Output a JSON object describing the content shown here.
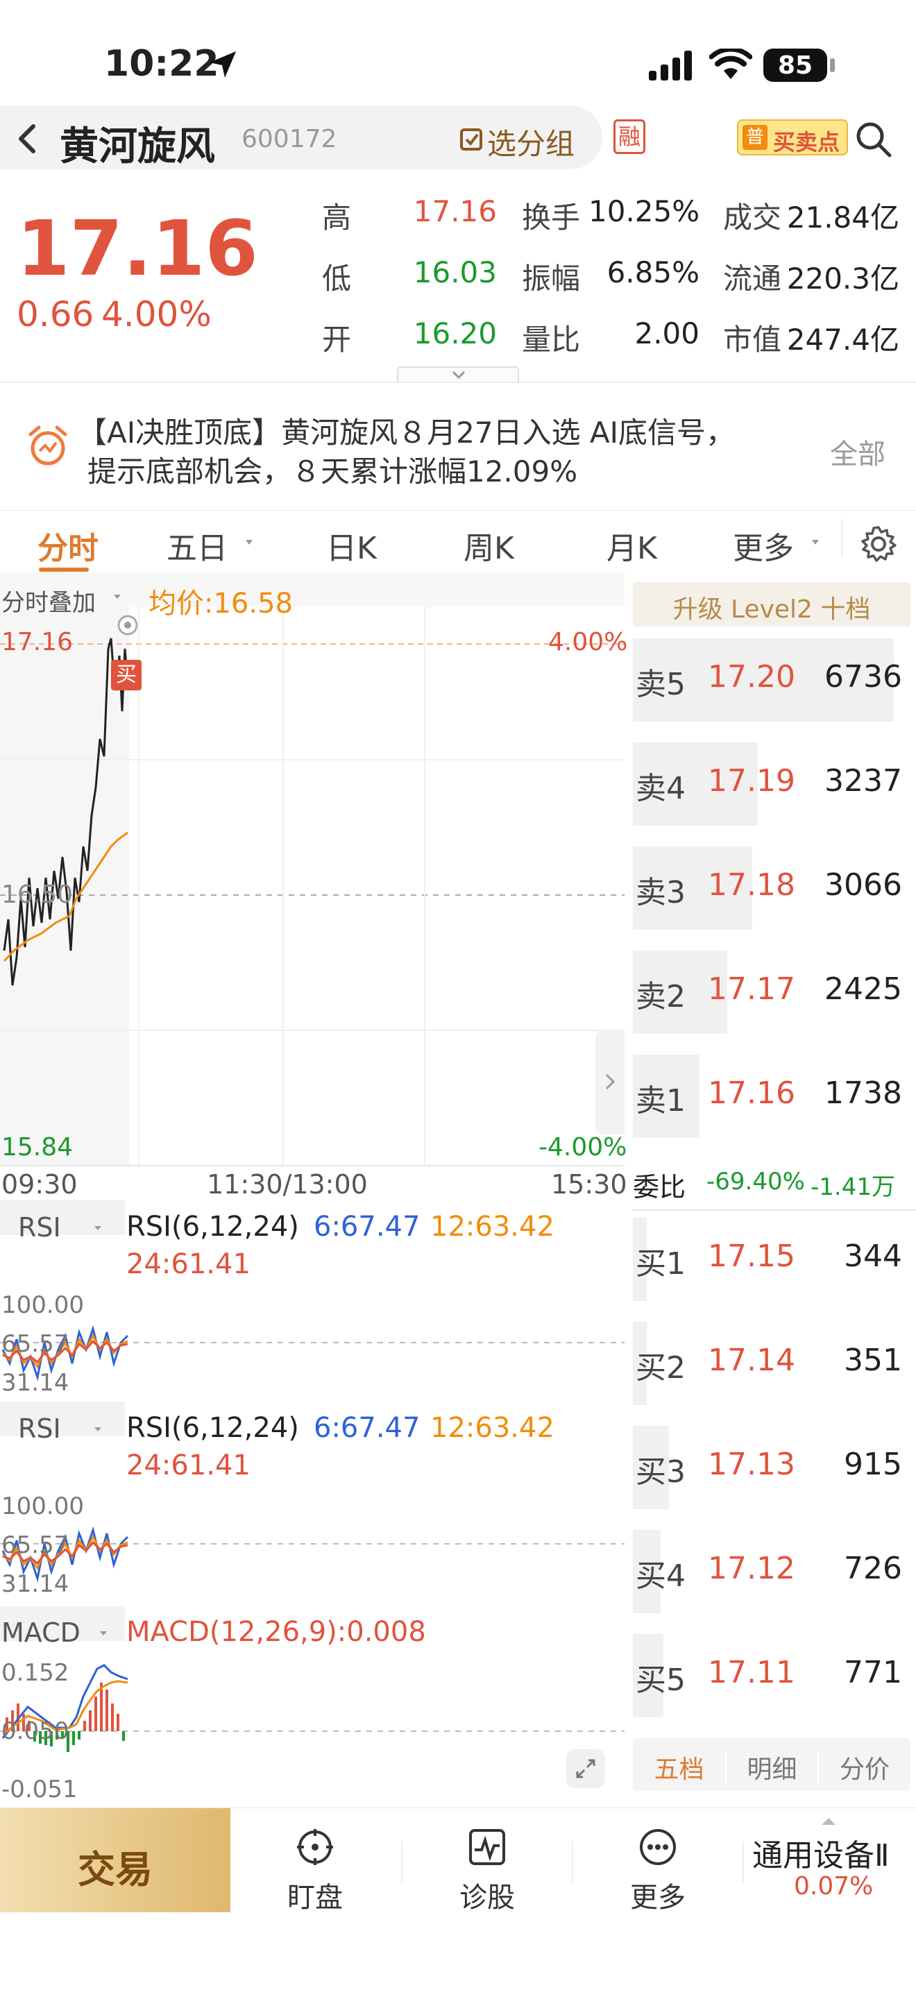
{
  "status": {
    "time": "10:22",
    "battery": "85"
  },
  "nav": {
    "name": "黄河旋风",
    "code": "600172",
    "group_btn": "选分组",
    "margin_badge": "融",
    "buy_sell_badge": "买卖点",
    "buy_sell_icon": "普"
  },
  "quote": {
    "price": "17.16",
    "change": "0.66",
    "change_pct": "4.00%",
    "high_label": "高",
    "high": "17.16",
    "low_label": "低",
    "low": "16.03",
    "open_label": "开",
    "open": "16.20",
    "turnover_label": "换手",
    "turnover": "10.25%",
    "amplitude_label": "振幅",
    "amplitude": "6.85%",
    "vol_ratio_label": "量比",
    "vol_ratio": "2.00",
    "deal_label": "成交",
    "deal": "21.84亿",
    "float_label": "流通",
    "float": "220.3亿",
    "cap_label": "市值",
    "cap": "247.4亿"
  },
  "ai": {
    "line1": "【AI决胜顶底】黄河旋风８月27日入选 AI底信号，",
    "line2": "提示底部机会，８天累计涨幅12.09%",
    "all": "全部"
  },
  "tabs": [
    "分时",
    "五日",
    "日K",
    "周K",
    "月K",
    "更多"
  ],
  "chart": {
    "overlay": "分时叠加",
    "avg": "均价:16.58",
    "top": "17.16",
    "top_pct": "4.00%",
    "mid": "16.50",
    "bottom": "15.84",
    "bottom_pct": "-4.00%",
    "buy_marker": "买",
    "t0": "09:30",
    "t1": "11:30/13:00",
    "t2": "15:30",
    "rsi_tab": "RSI",
    "rsi_title": "RSI(6,12,24)",
    "rsi6": "6:67.47",
    "rsi12": "12:63.42",
    "rsi24": "24:61.41",
    "rsi_l1": "100.00",
    "rsi_l2": "65.57",
    "rsi_l3": "31.14",
    "macd_tab": "MACD",
    "macd_title": "MACD(12,26,9):0.008",
    "macd_l1": "0.152",
    "macd_l2": "0.050",
    "macd_l3": "-0.051"
  },
  "book": {
    "header": "升级 Level2 十档",
    "asks": [
      {
        "l": "卖5",
        "p": "17.20",
        "v": "6736",
        "w": 0.94
      },
      {
        "l": "卖4",
        "p": "17.19",
        "v": "3237",
        "w": 0.45
      },
      {
        "l": "卖3",
        "p": "17.18",
        "v": "3066",
        "w": 0.43
      },
      {
        "l": "卖2",
        "p": "17.17",
        "v": "2425",
        "w": 0.34
      },
      {
        "l": "卖1",
        "p": "17.16",
        "v": "1738",
        "w": 0.24
      }
    ],
    "wb_label": "委比",
    "wb": "-69.40%",
    "wb2": "-1.41万",
    "bids": [
      {
        "l": "买1",
        "p": "17.15",
        "v": "344",
        "w": 0.05
      },
      {
        "l": "买2",
        "p": "17.14",
        "v": "351",
        "w": 0.05
      },
      {
        "l": "买3",
        "p": "17.13",
        "v": "915",
        "w": 0.13
      },
      {
        "l": "买4",
        "p": "17.12",
        "v": "726",
        "w": 0.1
      },
      {
        "l": "买5",
        "p": "17.11",
        "v": "771",
        "w": 0.11
      }
    ],
    "tabs": [
      "五档",
      "明细",
      "分价"
    ]
  },
  "bottom": {
    "trade": "交易",
    "watch": "盯盘",
    "diag": "诊股",
    "more": "更多",
    "sector": "通用设备Ⅱ",
    "sector_pct": "0.07%"
  }
}
